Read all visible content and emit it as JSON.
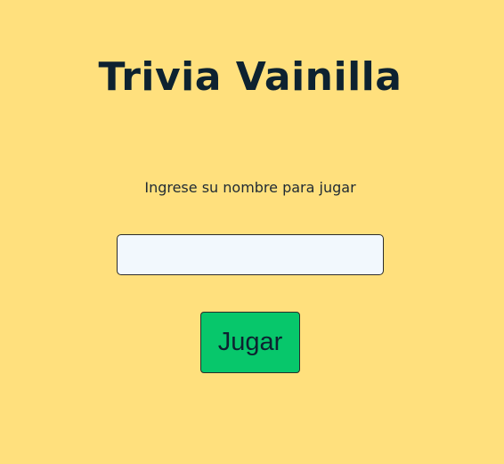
{
  "page": {
    "title": "Trivia Vainilla",
    "prompt": "Ingrese su nombre para jugar"
  },
  "form": {
    "name_value": "",
    "name_placeholder": "",
    "play_label": "Jugar"
  },
  "colors": {
    "background": "#ffe07d",
    "title": "#0d2230",
    "input_background": "#f2f8fd",
    "button_background": "#07c76b"
  }
}
